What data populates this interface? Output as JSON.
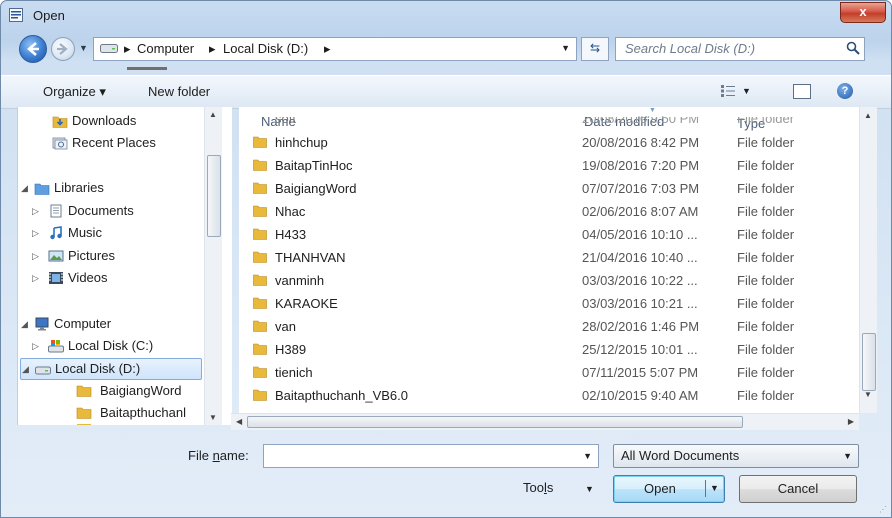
{
  "window": {
    "title": "Open",
    "close_label": "x"
  },
  "address_bar": {
    "segments": [
      "Computer",
      "Local Disk (D:)"
    ],
    "separator": "▸",
    "search_placeholder": "Search Local Disk (D:)"
  },
  "toolbar": {
    "organize_label": "Organize ▾",
    "new_folder_label": "New folder",
    "help_label": "?"
  },
  "nav_pane": {
    "items": [
      {
        "label": "Downloads",
        "icon": "downloads-icon"
      },
      {
        "label": "Recent Places",
        "icon": "recent-places-icon"
      },
      {
        "label": "Libraries",
        "icon": "libraries-icon"
      },
      {
        "label": "Documents",
        "icon": "documents-icon"
      },
      {
        "label": "Music",
        "icon": "music-icon"
      },
      {
        "label": "Pictures",
        "icon": "pictures-icon"
      },
      {
        "label": "Videos",
        "icon": "videos-icon"
      },
      {
        "label": "Computer",
        "icon": "computer-icon"
      },
      {
        "label": "Local Disk (C:)",
        "icon": "drive-icon"
      },
      {
        "label": "Local Disk (D:)",
        "icon": "drive-icon",
        "selected": true
      },
      {
        "label": "BaigiangWord",
        "icon": "folder-icon"
      },
      {
        "label": "Baitapthuchanl",
        "icon": "folder-icon"
      }
    ]
  },
  "file_list": {
    "columns": {
      "name": "Name",
      "date": "Date modified",
      "type": "Type"
    },
    "rows": [
      {
        "name": "soft",
        "date": "20/08/2016 9:50 PM",
        "type": "File folder"
      },
      {
        "name": "hinhchup",
        "date": "20/08/2016 8:42 PM",
        "type": "File folder"
      },
      {
        "name": "BaitapTinHoc",
        "date": "19/08/2016 7:20 PM",
        "type": "File folder"
      },
      {
        "name": "BaigiangWord",
        "date": "07/07/2016 7:03 PM",
        "type": "File folder"
      },
      {
        "name": "Nhac",
        "date": "02/06/2016 8:07 AM",
        "type": "File folder"
      },
      {
        "name": "H433",
        "date": "04/05/2016 10:10 ...",
        "type": "File folder"
      },
      {
        "name": "THANHVAN",
        "date": "21/04/2016 10:40 ...",
        "type": "File folder"
      },
      {
        "name": "vanminh",
        "date": "03/03/2016 10:22 ...",
        "type": "File folder"
      },
      {
        "name": "KARAOKE",
        "date": "03/03/2016 10:21 ...",
        "type": "File folder"
      },
      {
        "name": "van",
        "date": "28/02/2016 1:46 PM",
        "type": "File folder"
      },
      {
        "name": "H389",
        "date": "25/12/2015 10:01 ...",
        "type": "File folder"
      },
      {
        "name": "tienich",
        "date": "07/11/2015 5:07 PM",
        "type": "File folder"
      },
      {
        "name": "Baitapthuchanh_VB6.0",
        "date": "02/10/2015 9:40 AM",
        "type": "File folder"
      }
    ]
  },
  "bottom": {
    "file_name_label_prefix": "File ",
    "file_name_label_underlined": "n",
    "file_name_label_suffix": "ame:",
    "file_name_value": "",
    "filter_value": "All Word Documents",
    "tools_label_prefix": "Too",
    "tools_label_underlined": "l",
    "tools_label_suffix": "s",
    "open_label": "Open",
    "cancel_label": "Cancel"
  },
  "colors": {
    "folder": "#e8b93a",
    "selection": "#cfe4fb",
    "accent": "#3c7fb1"
  }
}
